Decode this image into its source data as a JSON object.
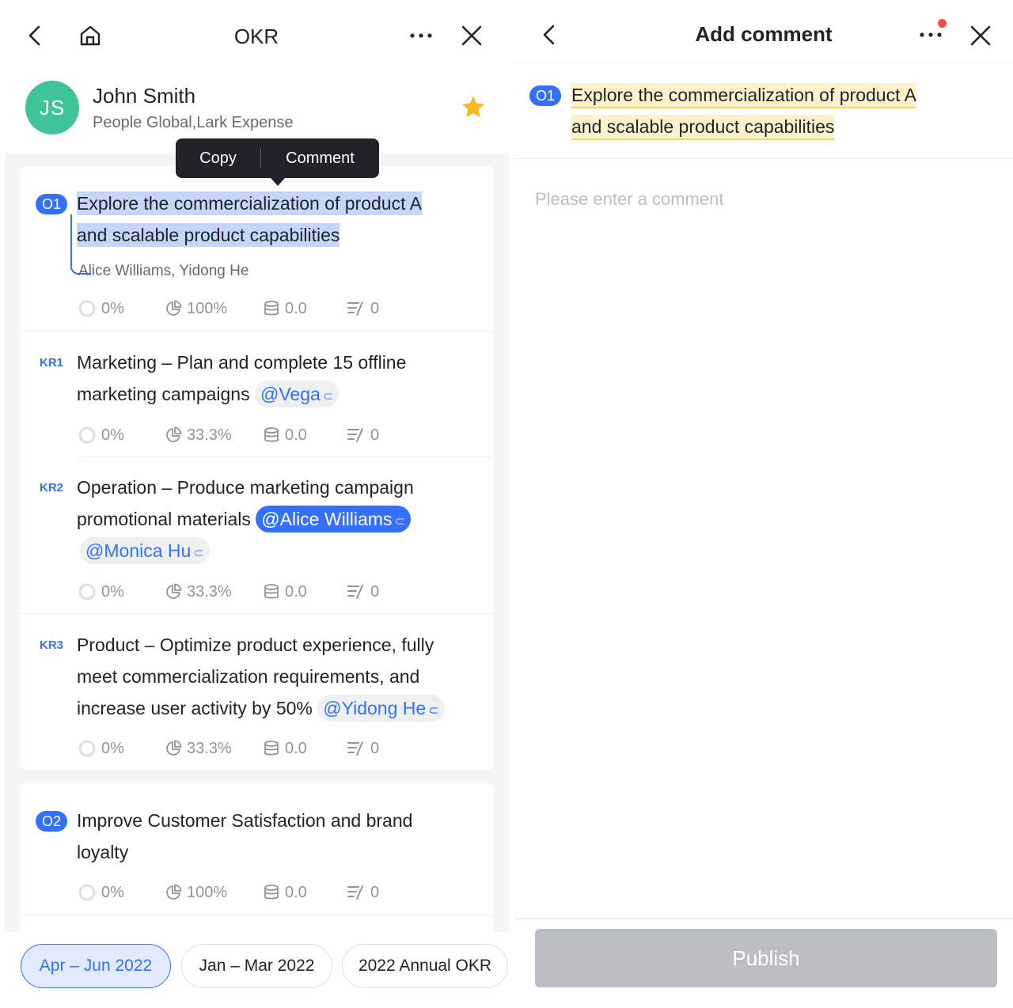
{
  "left": {
    "header": {
      "title": "OKR"
    },
    "user": {
      "initials": "JS",
      "name": "John Smith",
      "dept": "People Global,Lark Expense"
    },
    "tooltip": {
      "copy": "Copy",
      "comment": "Comment"
    },
    "o1": {
      "tag": "O1",
      "line1": "Explore the commercialization of product A",
      "line2": "and scalable product capabilities",
      "owners": "Alice Williams, Yidong He",
      "stats": {
        "progress": "0%",
        "weight": "100%",
        "score": "0.0",
        "comments": "0"
      }
    },
    "kr1": {
      "tag": "KR1",
      "line1": "Marketing – Plan and complete 15 offline",
      "line2": "marketing campaigns",
      "mention": "@Vega",
      "stats": {
        "progress": "0%",
        "weight": "33.3%",
        "score": "0.0",
        "comments": "0"
      }
    },
    "kr2": {
      "tag": "KR2",
      "line1": "Operation – Produce marketing campaign",
      "line2": "promotional materials",
      "mention1": "@Alice Williams",
      "mention2": "@Monica Hu",
      "stats": {
        "progress": "0%",
        "weight": "33.3%",
        "score": "0.0",
        "comments": "0"
      }
    },
    "kr3": {
      "tag": "KR3",
      "line1": "Product – Optimize product experience, fully",
      "line2": "meet commercialization requirements, and",
      "line3": "increase user activity by 50%",
      "mention": "@Yidong He",
      "stats": {
        "progress": "0%",
        "weight": "33.3%",
        "score": "0.0",
        "comments": "0"
      }
    },
    "o2": {
      "tag": "O2",
      "line1": "Improve Customer Satisfaction and brand",
      "line2": "loyalty",
      "stats": {
        "progress": "0%",
        "weight": "100%",
        "score": "0.0",
        "comments": "0"
      }
    },
    "periods": [
      "Apr – Jun 2022",
      "Jan – Mar 2022",
      "2022 Annual OKR"
    ]
  },
  "right": {
    "title": "Add comment",
    "quote_tag": "O1",
    "quote_line1": "Explore the commercialization of product A",
    "quote_line2": "and scalable product capabilities",
    "placeholder": "Please enter a comment",
    "publish": "Publish"
  },
  "colors": {
    "accent": "#3370ff",
    "avatar": "#3ec39a",
    "star": "#f7ba1e",
    "highlight": "#c6d6fb",
    "quote_highlight": "#fcf3cc"
  }
}
